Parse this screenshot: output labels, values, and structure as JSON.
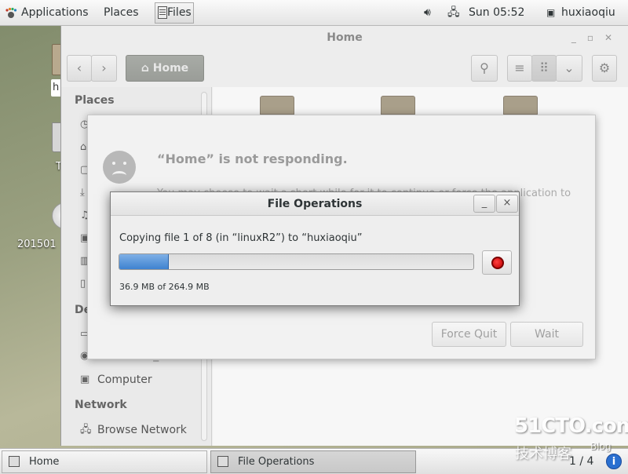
{
  "topbar": {
    "applications": "Applications",
    "places": "Places",
    "files": "Files",
    "clock": "Sun 05:52",
    "user": "huxiaoqiu"
  },
  "desktop": {
    "home_label": "h",
    "trash_label": "T",
    "disc_label": "201501"
  },
  "nautilus": {
    "title": "Home",
    "path_button": "Home",
    "sidebar": {
      "places_heading": "Places",
      "devices_heading": "De",
      "device_disc": "20150114_2...",
      "computer": "Computer",
      "network_heading": "Network",
      "browse_network": "Browse Network"
    }
  },
  "not_responding": {
    "title": "“Home” is not responding.",
    "body": "You may choose to wait a short while for it to continue or force the application to",
    "force_quit": "Force Quit",
    "wait": "Wait"
  },
  "file_operations": {
    "title": "File Operations",
    "status": "Copying file 1 of 8 (in “linuxR2”) to “huxiaoqiu”",
    "progress_fraction": 0.139,
    "size": "36.9 MB of 264.9 MB",
    "minimize": "_",
    "close": "×"
  },
  "taskbar": {
    "task_home": "Home",
    "task_file_operations": "File Operations",
    "page_indicator": "1 / 4"
  },
  "watermark": {
    "main": "51CTO.com",
    "sub": "技术博客",
    "blog": "Blog"
  },
  "colors": {
    "progress": "#3e82d0",
    "stop": "#d00000",
    "panel": "#ededed"
  },
  "icons": [
    "foot-icon",
    "files-icon",
    "volume-icon",
    "network-icon",
    "user-icon",
    "home-icon",
    "search-icon",
    "list-view-icon",
    "grid-view-icon",
    "chevron-down-icon",
    "gear-icon",
    "back-icon",
    "forward-icon",
    "stop-icon",
    "sad-face-icon",
    "info-icon"
  ]
}
